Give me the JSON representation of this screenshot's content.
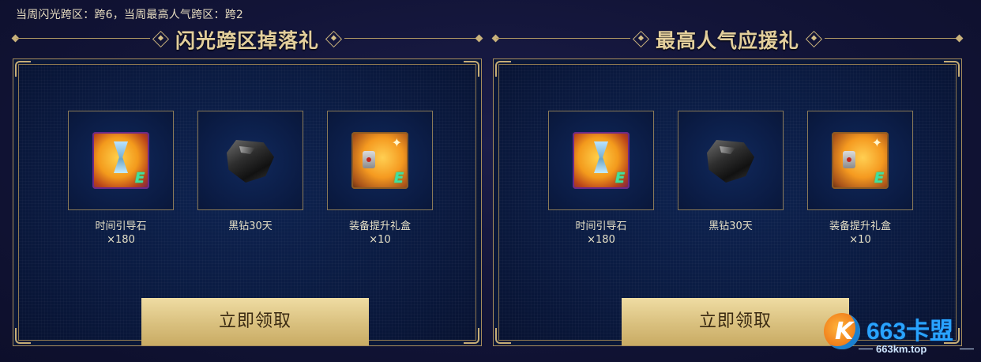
{
  "info_text": "当周闪光跨区：跨6，当周最高人气跨区：跨2",
  "sections": [
    {
      "title": "闪光跨区掉落礼",
      "items": [
        {
          "icon": "hourglass-orb-icon",
          "label": "时间引导石",
          "count": "×180"
        },
        {
          "icon": "black-diamond-icon",
          "label": "黑钻30天",
          "count": ""
        },
        {
          "icon": "treasure-chest-icon",
          "label": "装备提升礼盒",
          "count": "×10"
        }
      ],
      "button_label": "立即领取"
    },
    {
      "title": "最高人气应援礼",
      "items": [
        {
          "icon": "hourglass-orb-icon",
          "label": "时间引导石",
          "count": "×180"
        },
        {
          "icon": "black-diamond-icon",
          "label": "黑钻30天",
          "count": ""
        },
        {
          "icon": "treasure-chest-icon",
          "label": "装备提升礼盒",
          "count": "×10"
        }
      ],
      "button_label": "立即领取"
    }
  ],
  "watermark": {
    "name": "663卡盟",
    "url": "663km.top"
  },
  "colors": {
    "gold": "#e3cf9c",
    "button": "#d9c07e",
    "panel": "#0a1a40",
    "background": "#121437"
  }
}
